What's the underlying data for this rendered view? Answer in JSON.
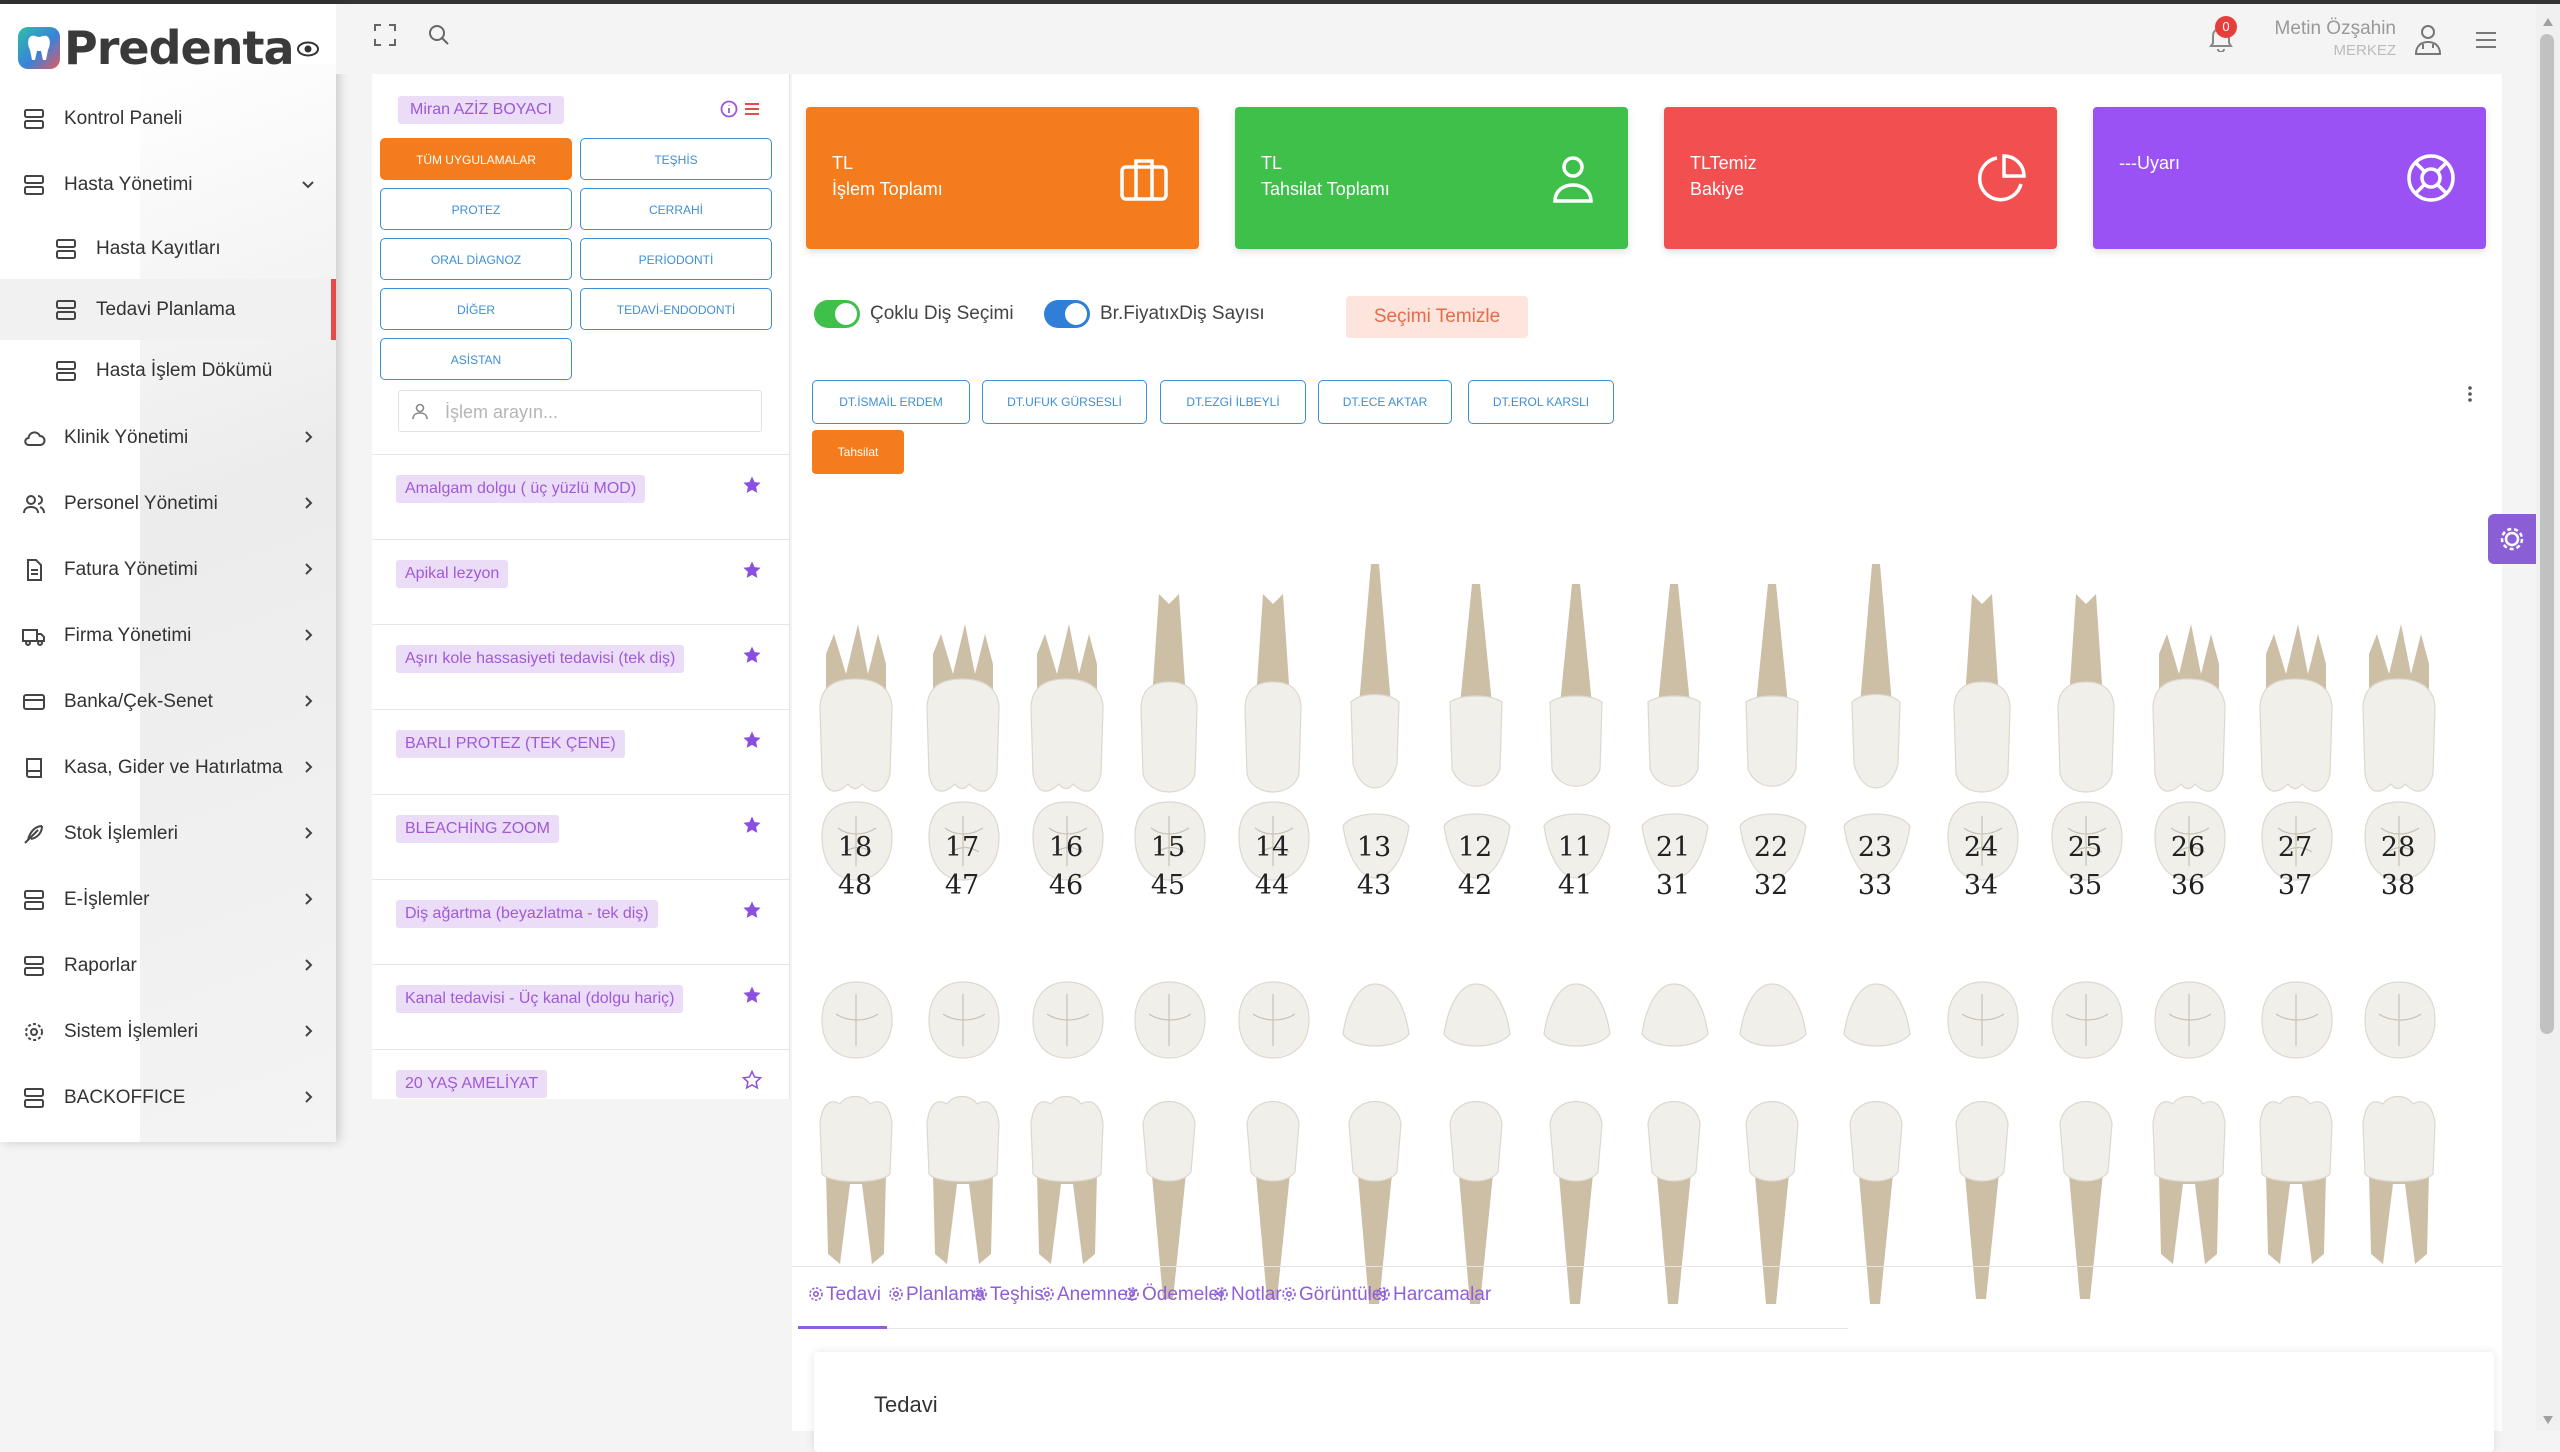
{
  "app": {
    "logo_text": "Predenta"
  },
  "sidebar": {
    "items": [
      {
        "id": "kontrol",
        "label": "Kontrol Paneli",
        "icon": "server-icon"
      },
      {
        "id": "hasta",
        "label": "Hasta Yönetimi",
        "icon": "server-icon",
        "expanded": true
      },
      {
        "id": "hasta-kayitlari",
        "label": "Hasta Kayıtları",
        "icon": "server-icon",
        "sub": true
      },
      {
        "id": "tedavi-planlama",
        "label": "Tedavi Planlama",
        "icon": "server-icon",
        "sub": true,
        "active": true
      },
      {
        "id": "hasta-islem",
        "label": "Hasta İşlem Dökümü",
        "icon": "server-icon",
        "sub": true
      },
      {
        "id": "klinik",
        "label": "Klinik Yönetimi",
        "icon": "cloud-icon"
      },
      {
        "id": "personel",
        "label": "Personel Yönetimi",
        "icon": "users-icon"
      },
      {
        "id": "fatura",
        "label": "Fatura Yönetimi",
        "icon": "file-icon"
      },
      {
        "id": "firma",
        "label": "Firma Yönetimi",
        "icon": "truck-icon"
      },
      {
        "id": "banka",
        "label": "Banka/Çek-Senet",
        "icon": "credit-card-icon"
      },
      {
        "id": "kasa",
        "label": "Kasa, Gider ve Hatırlatma",
        "icon": "book-icon"
      },
      {
        "id": "stok",
        "label": "Stok İşlemleri",
        "icon": "feather-icon"
      },
      {
        "id": "e-islemler",
        "label": "E-İşlemler",
        "icon": "server-icon"
      },
      {
        "id": "raporlar",
        "label": "Raporlar",
        "icon": "server-icon"
      },
      {
        "id": "sistem",
        "label": "Sistem İşlemleri",
        "icon": "settings-icon"
      },
      {
        "id": "backoffice",
        "label": "BACKOFFICE",
        "icon": "server-icon"
      }
    ]
  },
  "header": {
    "notification_count": "0",
    "user_name": "Metin Özşahin",
    "user_branch": "MERKEZ"
  },
  "procedures": {
    "patient_name": "Miran AZİZ BOYACI",
    "categories": [
      "TÜM UYGULAMALAR",
      "TEŞHİS",
      "PROTEZ",
      "CERRAHİ",
      "ORAL DİAGNOZ",
      "PERİODONTİ",
      "DİĞER",
      "TEDAVİ-ENDODONTİ",
      "ASİSTAN"
    ],
    "search_placeholder": "İşlem arayın...",
    "items": [
      {
        "name": "Amalgam dolgu ( üç yüzlü MOD)",
        "starred": true
      },
      {
        "name": "Apikal lezyon",
        "starred": true
      },
      {
        "name": "Aşırı kole hassasiyeti tedavisi (tek diş)",
        "starred": true
      },
      {
        "name": "BARLI PROTEZ (TEK ÇENE)",
        "starred": true
      },
      {
        "name": "BLEACHİNG ZOOM",
        "starred": true
      },
      {
        "name": "Diş ağartma (beyazlatma - tek diş)",
        "starred": true
      },
      {
        "name": "Kanal tedavisi - Üç kanal (dolgu hariç)",
        "starred": true
      },
      {
        "name": "20 YAŞ AMELİYAT",
        "starred": false
      }
    ]
  },
  "stats": [
    {
      "line1": "TL",
      "line2": "İşlem Toplamı",
      "color": "#f47c1c",
      "icon": "briefcase-icon"
    },
    {
      "line1": "TL",
      "line2": "Tahsilat Toplamı",
      "color": "#3ec04b",
      "icon": "user-icon"
    },
    {
      "line1": "TLTemiz",
      "line2": "Bakiye",
      "color": "#f25050",
      "icon": "pie-chart-icon"
    },
    {
      "line1": "---Uyarı",
      "line2": "",
      "color": "#9a52f5",
      "icon": "life-buoy-icon"
    }
  ],
  "controls": {
    "multi_select_label": "Çoklu Diş Seçimi",
    "price_label": "Br.FiyatıxDiş Sayısı",
    "clear_label": "Seçimi Temizle",
    "doctors": [
      "DT.İSMAİL ERDEM",
      "DT.UFUK GÜRSESLİ",
      "DT.EZGİ İLBEYLİ",
      "DT.ECE AKTAR",
      "DT.EROL KARSLI"
    ],
    "payment_label": "Tahsilat"
  },
  "teeth": {
    "upper_numbers": [
      "18",
      "17",
      "16",
      "15",
      "14",
      "13",
      "12",
      "11",
      "21",
      "22",
      "23",
      "24",
      "25",
      "26",
      "27",
      "28"
    ],
    "lower_numbers": [
      "48",
      "47",
      "46",
      "45",
      "44",
      "43",
      "42",
      "41",
      "31",
      "32",
      "33",
      "34",
      "35",
      "36",
      "37",
      "38"
    ]
  },
  "tabs": [
    "Tedavi",
    "Planlama",
    "Teşhis",
    "Anemnez",
    "Ödemeler",
    "Notlar",
    "Görüntüler",
    "Harcamalar"
  ],
  "content": {
    "title": "Tedavi"
  }
}
